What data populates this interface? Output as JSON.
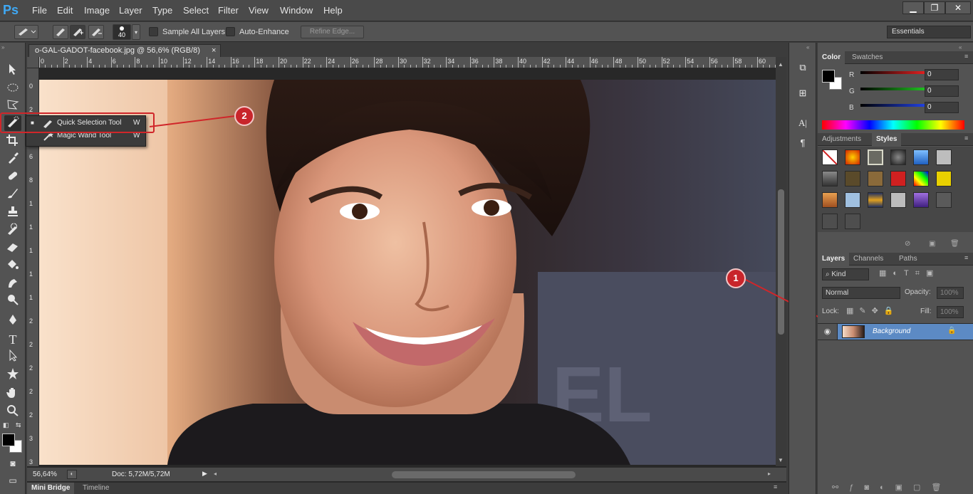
{
  "app": {
    "logo": "Ps"
  },
  "menubar": {
    "items": [
      "File",
      "Edit",
      "Image",
      "Layer",
      "Type",
      "Select",
      "Filter",
      "View",
      "Window",
      "Help"
    ]
  },
  "window_controls": {
    "minimize": "▁",
    "restore": "❐",
    "close": "✕"
  },
  "options": {
    "brush_size": "40",
    "sample_all_layers": "Sample All Layers",
    "auto_enhance": "Auto-Enhance",
    "refine_edge": "Refine Edge...",
    "workspace": "Essentials"
  },
  "document": {
    "tab_title": "o-GAL-GADOT-facebook.jpg @ 56,6% (RGB/8)",
    "close_glyph": "×",
    "ruler_h": [
      "0",
      "2",
      "4",
      "6",
      "8",
      "10",
      "12",
      "14",
      "16",
      "18",
      "20",
      "22",
      "24",
      "26",
      "28",
      "30",
      "32",
      "34",
      "36",
      "38",
      "40",
      "42",
      "44",
      "46",
      "48",
      "50",
      "52",
      "54",
      "56",
      "58",
      "60",
      "62"
    ],
    "ruler_v": [
      "0",
      "2",
      "4",
      "6",
      "8",
      "1",
      "1",
      "1",
      "1",
      "1",
      "2",
      "2",
      "2",
      "2",
      "2",
      "3",
      "3"
    ],
    "zoom": "56,64%",
    "doc_size": "Doc: 5,72M/5,72M"
  },
  "bottom_tabs": [
    "Mini Bridge",
    "Timeline"
  ],
  "flyout": {
    "items": [
      {
        "label": "Quick Selection Tool",
        "shortcut": "W",
        "icon": "quick-selection-icon"
      },
      {
        "label": "Magic Wand Tool",
        "shortcut": "W",
        "icon": "magic-wand-icon"
      }
    ]
  },
  "callouts": [
    "1",
    "2"
  ],
  "color_panel": {
    "tabs": [
      "Color",
      "Swatches"
    ],
    "channels": [
      {
        "label": "R",
        "value": "0",
        "color": "#e02020"
      },
      {
        "label": "G",
        "value": "0",
        "color": "#20c020"
      },
      {
        "label": "B",
        "value": "0",
        "color": "#2040e0"
      }
    ]
  },
  "styles_panel": {
    "tabs": [
      "Adjustments",
      "Styles"
    ]
  },
  "layers_panel": {
    "tabs": [
      "Layers",
      "Channels",
      "Paths"
    ],
    "kind": "Kind",
    "blend_mode": "Normal",
    "opacity_label": "Opacity:",
    "opacity_value": "100%",
    "lock_label": "Lock:",
    "fill_label": "Fill:",
    "fill_value": "100%",
    "layers": [
      {
        "name": "Background"
      }
    ]
  }
}
